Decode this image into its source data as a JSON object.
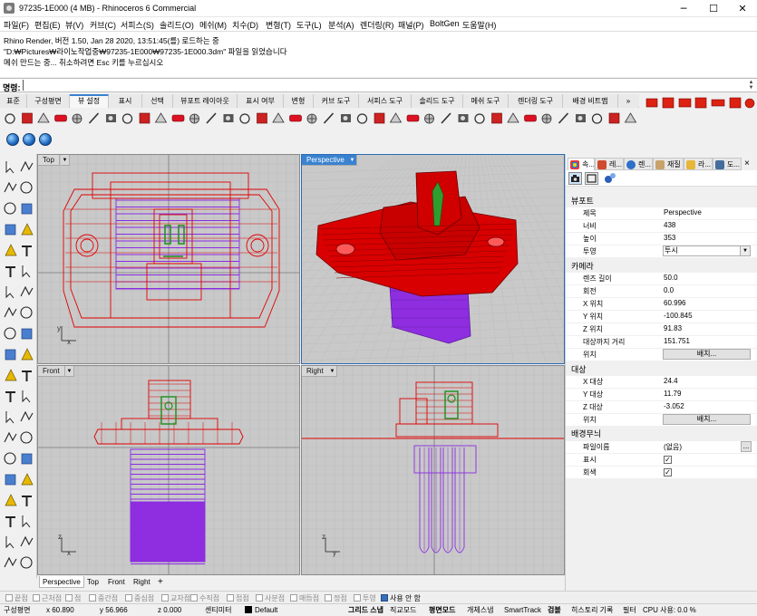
{
  "window": {
    "title": "97235-1E000 (4 MB) - Rhinoceros 6 Commercial",
    "minimize": "─",
    "maximize": "☐",
    "close": "✕"
  },
  "menu": [
    "파일(F)",
    "편집(E)",
    "뷰(V)",
    "커브(C)",
    "서피스(S)",
    "솔리드(O)",
    "메쉬(M)",
    "치수(D)",
    "변형(T)",
    "도구(L)",
    "분석(A)",
    "렌더링(R)",
    "패널(P)",
    "BoltGen",
    "도움말(H)"
  ],
  "history": [
    "Rhino Render, 버전 1.50, Jan 28 2020, 13:51:45(를) 로드하는 중",
    "\"D:₩Pictures₩라이노작업중₩97235-1E000₩97235-1E000.3dm\" 파일을 읽었습니다",
    "메쉬 만드는 중... 취소하려면 Esc 키를 누르십시오"
  ],
  "command": {
    "label": "명령:",
    "value": ""
  },
  "tabs": [
    "표준",
    "구성평면",
    "뷰 설정",
    "표시",
    "선택",
    "뷰포트 레이아웃",
    "표시 여부",
    "변형",
    "커브 도구",
    "서피스 도구",
    "솔리드 도구",
    "메쉬 도구",
    "렌더링 도구",
    "배경 비트맵"
  ],
  "tabs_more": "»",
  "viewports": {
    "top": {
      "label": "Top"
    },
    "perspective": {
      "label": "Perspective"
    },
    "front": {
      "label": "Front"
    },
    "right": {
      "label": "Right"
    }
  },
  "viewport_tabs": [
    "Perspective",
    "Top",
    "Front",
    "Right"
  ],
  "viewport_tab_add": "+",
  "axes": {
    "x": "x",
    "y": "y",
    "z": "z"
  },
  "panel": {
    "tabs": [
      "속...",
      "레...",
      "렌...",
      "재질",
      "라...",
      "도..."
    ],
    "close": "×",
    "sections": {
      "viewport": "뷰포트",
      "camera": "카메라",
      "target": "대상",
      "wallpaper": "배경무늬"
    },
    "viewport_rows": [
      {
        "label": "제목",
        "value": "Perspective"
      },
      {
        "label": "너비",
        "value": "438"
      },
      {
        "label": "높이",
        "value": "353"
      },
      {
        "label": "투영",
        "value": "투시"
      }
    ],
    "camera_rows": [
      {
        "label": "렌즈 길이",
        "value": "50.0"
      },
      {
        "label": "회전",
        "value": "0.0"
      },
      {
        "label": "X 위치",
        "value": "60.996"
      },
      {
        "label": "Y 위치",
        "value": "-100.845"
      },
      {
        "label": "Z 위치",
        "value": "91.83"
      },
      {
        "label": "대상까지 거리",
        "value": "151.751"
      },
      {
        "label": "위치",
        "value": "배치..."
      }
    ],
    "target_rows": [
      {
        "label": "X 대상",
        "value": "24.4"
      },
      {
        "label": "Y 대상",
        "value": "11.79"
      },
      {
        "label": "Z 대상",
        "value": "-3.052"
      },
      {
        "label": "위치",
        "value": "배치..."
      }
    ],
    "wallpaper_rows": [
      {
        "label": "파일이름",
        "value": "(없음)"
      },
      {
        "label": "표시",
        "value": "✓"
      },
      {
        "label": "회색",
        "value": "✓"
      }
    ],
    "file_button": "..."
  },
  "osnaps": [
    {
      "label": "끝점",
      "checked": false
    },
    {
      "label": "근처점",
      "checked": false
    },
    {
      "label": "점",
      "checked": false
    },
    {
      "label": "중간점",
      "checked": false
    },
    {
      "label": "중심점",
      "checked": false
    },
    {
      "label": "교차점",
      "checked": false
    },
    {
      "label": "수직점",
      "checked": false
    },
    {
      "label": "접점",
      "checked": false
    },
    {
      "label": "사분점",
      "checked": false
    },
    {
      "label": "매듭점",
      "checked": false
    },
    {
      "label": "정점",
      "checked": false
    },
    {
      "label": "투영",
      "checked": false
    },
    {
      "label": "사용 안 함",
      "checked": true
    }
  ],
  "status": {
    "cplane": "구성평면",
    "x": "x 60.890",
    "y": "y 56.966",
    "z": "z 0.000",
    "units": "센티미터",
    "layer": "Default",
    "toggles": [
      "그리드 스냅",
      "직교모드",
      "평면모드",
      "개체스냅",
      "SmartTrack",
      "검볼",
      "히스토리 기록",
      "필터"
    ],
    "cpu": "CPU 사용: 0.0 %"
  },
  "colors": {
    "accent": "#3a82d0",
    "model_red": "#e00000",
    "model_purple": "#8a2be2",
    "model_green": "#2e9e2e",
    "viewport_bg": "#c9c9c9"
  }
}
